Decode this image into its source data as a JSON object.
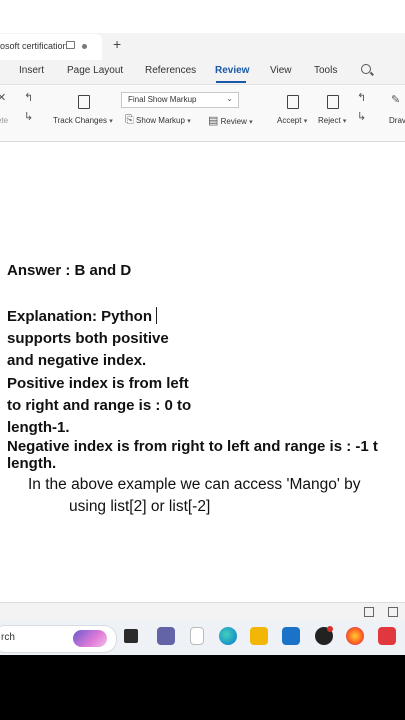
{
  "browser": {
    "tab_title": "osoft certification",
    "new_tab_label": "+"
  },
  "ribbon": {
    "tabs": [
      {
        "label": "Insert"
      },
      {
        "label": "Page Layout"
      },
      {
        "label": "References"
      },
      {
        "label": "Review",
        "active": true
      },
      {
        "label": "View"
      },
      {
        "label": "Tools"
      }
    ]
  },
  "toolbar": {
    "partial_left_label": "ete",
    "markup_select": "Final Show Markup",
    "track_changes": "Track Changes",
    "show_markup": "Show Markup",
    "review": "Review",
    "accept": "Accept",
    "reject": "Reject",
    "draw": "Drav"
  },
  "document": {
    "answer": "Answer :  B and D",
    "explanation_lines": [
      "Explanation: Python",
      "supports both positive",
      "and negative index.",
      "Positive index is from left",
      "to right and range is : 0 to",
      "length-1."
    ],
    "negative_line1": "Negative index is from right to left and range is : -1 t",
    "negative_line2": "length.",
    "example_line1": "In the above example we can access 'Mango' by",
    "example_line2": "using list[2] or list[-2]"
  },
  "taskbar": {
    "search_text": "rch"
  },
  "colors": {
    "accent": "#1a5aa8",
    "ribbon_bg": "#f3f3f3",
    "taskbar_bg": "#eef1f6"
  }
}
